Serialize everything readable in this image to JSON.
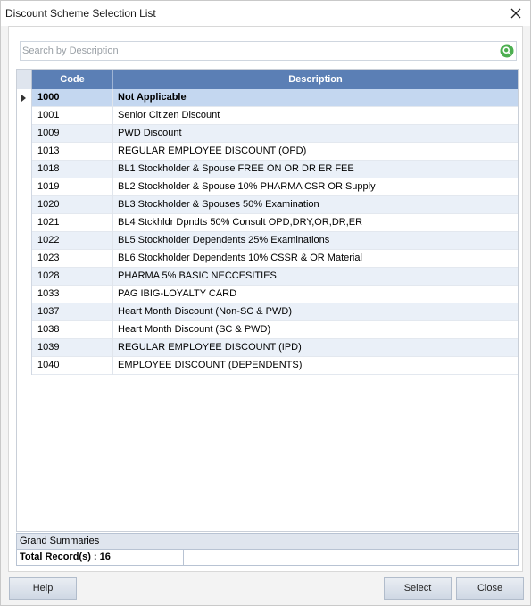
{
  "window": {
    "title": "Discount Scheme Selection List"
  },
  "search": {
    "placeholder": "Search by Description"
  },
  "grid": {
    "columns": [
      "Code",
      "Description"
    ],
    "rows": [
      {
        "code": "1000",
        "description": "Not Applicable",
        "selected": true
      },
      {
        "code": "1001",
        "description": "Senior Citizen Discount"
      },
      {
        "code": "1009",
        "description": "PWD Discount"
      },
      {
        "code": "1013",
        "description": "REGULAR EMPLOYEE DISCOUNT (OPD)"
      },
      {
        "code": "1018",
        "description": "BL1 Stockholder & Spouse FREE ON OR DR ER FEE"
      },
      {
        "code": "1019",
        "description": "BL2 Stockholder & Spouse 10% PHARMA CSR OR Supply"
      },
      {
        "code": "1020",
        "description": "BL3 Stockholder & Spouses 50% Examination"
      },
      {
        "code": "1021",
        "description": "BL4 Stckhldr Dpndts 50% Consult OPD,DRY,OR,DR,ER"
      },
      {
        "code": "1022",
        "description": "BL5 Stockholder Dependents 25% Examinations"
      },
      {
        "code": "1023",
        "description": "BL6 Stockholder Dependents 10% CSSR & OR Material"
      },
      {
        "code": "1028",
        "description": "PHARMA 5% BASIC NECCESITIES"
      },
      {
        "code": "1033",
        "description": "PAG IBIG-LOYALTY CARD"
      },
      {
        "code": "1037",
        "description": "Heart Month Discount (Non-SC & PWD)"
      },
      {
        "code": "1038",
        "description": "Heart Month Discount (SC & PWD)"
      },
      {
        "code": "1039",
        "description": "REGULAR EMPLOYEE DISCOUNT (IPD)"
      },
      {
        "code": "1040",
        "description": "EMPLOYEE DISCOUNT (DEPENDENTS)"
      }
    ]
  },
  "summary": {
    "title": "Grand Summaries",
    "total_label": "Total Record(s) : 16"
  },
  "buttons": {
    "help": "Help",
    "select": "Select",
    "close": "Close"
  },
  "colors": {
    "header": "#5b7fb5",
    "selected_row": "#c4d7f0",
    "alt_row": "#eaf0f8",
    "search_icon": "#4caf50"
  },
  "icons": {
    "close": "close-icon",
    "search": "search-icon",
    "row_pointer": "row-pointer-icon"
  }
}
